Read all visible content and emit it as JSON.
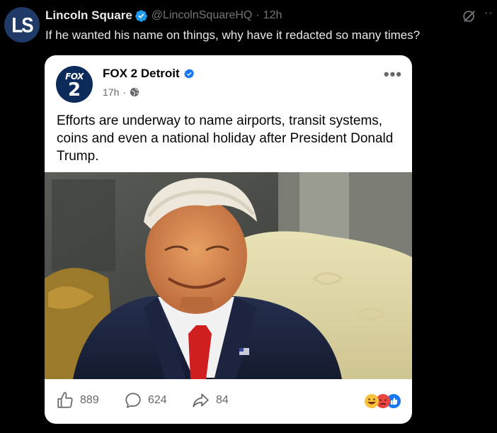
{
  "tweet": {
    "avatar_text": "LS",
    "display_name": "Lincoln Square",
    "handle": "@LincolnSquareHQ",
    "separator": "·",
    "time": "12h",
    "more": "··",
    "text": "If he wanted his name on things, why have it redacted so many times?"
  },
  "card": {
    "avatar_brand": "FOX",
    "avatar_number": "2",
    "page_name": "FOX 2 Detroit",
    "post_time": "17h",
    "separator": "·",
    "more": "•••",
    "post_text": "Efforts are underway to name airports, transit systems, coins and even a national holiday after President Donald Trump.",
    "photo_description": "",
    "likes": "889",
    "comments": "624",
    "shares": "84"
  },
  "colors": {
    "background": "#000000",
    "twitter_blue": "#1d9bf0",
    "muted": "#71767b",
    "facebook_blue": "#1877f2",
    "card_bg": "#ffffff"
  },
  "icons": [
    "verified-badge-icon",
    "grok-icon",
    "globe-icon",
    "like-icon",
    "comment-icon",
    "share-icon",
    "reactions-icon"
  ]
}
